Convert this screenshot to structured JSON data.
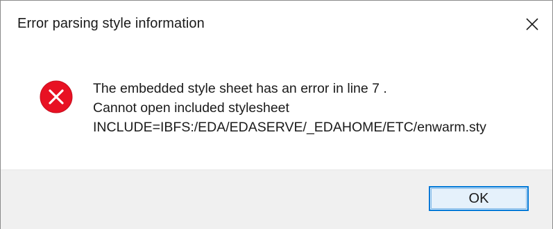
{
  "window": {
    "title": "Error parsing style information",
    "close_icon": "close-icon"
  },
  "message": {
    "icon": "error-icon",
    "lines": [
      "The embedded style sheet has an error in line 7 .",
      "Cannot open included stylesheet",
      "INCLUDE=IBFS:/EDA/EDASERVE/_EDAHOME/ETC/enwarm.sty"
    ]
  },
  "buttons": {
    "ok_label": "OK"
  },
  "colors": {
    "error_red": "#e81123",
    "button_border": "#0078d7",
    "footer_bg": "#f0f0f0"
  }
}
